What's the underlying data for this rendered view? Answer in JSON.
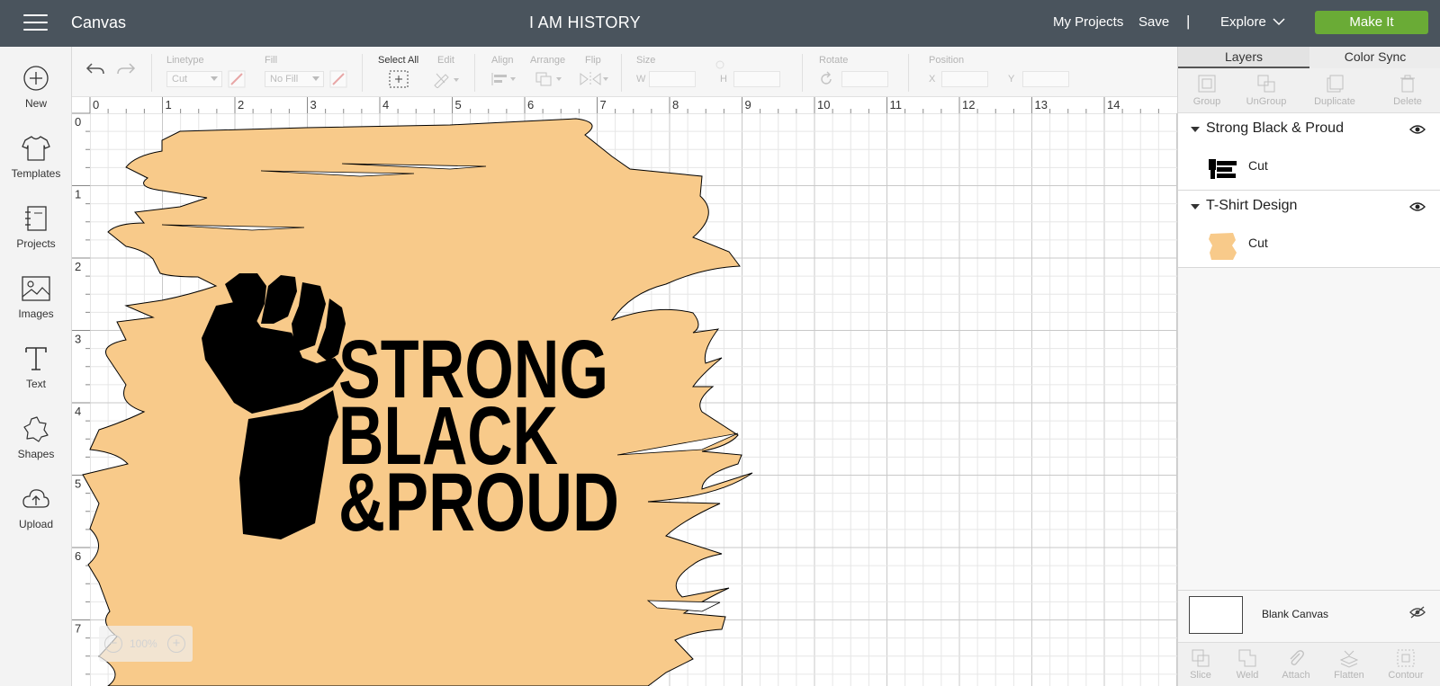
{
  "app": {
    "name": "Canvas",
    "project_title": "I AM HISTORY",
    "my_projects": "My Projects",
    "save": "Save",
    "separator": "|",
    "explore": "Explore",
    "make_it": "Make It"
  },
  "sidebar": {
    "items": [
      {
        "label": "New",
        "icon": "plus-circle-icon"
      },
      {
        "label": "Templates",
        "icon": "tshirt-icon"
      },
      {
        "label": "Projects",
        "icon": "notebook-icon"
      },
      {
        "label": "Images",
        "icon": "image-icon"
      },
      {
        "label": "Text",
        "icon": "text-icon"
      },
      {
        "label": "Shapes",
        "icon": "shapes-icon"
      },
      {
        "label": "Upload",
        "icon": "upload-cloud-icon"
      }
    ]
  },
  "toolbar": {
    "linetype_label": "Linetype",
    "linetype_value": "Cut",
    "fill_label": "Fill",
    "fill_value": "No Fill",
    "select_all": "Select All",
    "edit": "Edit",
    "align": "Align",
    "arrange": "Arrange",
    "flip": "Flip",
    "size": "Size",
    "size_w": "W",
    "size_h": "H",
    "rotate": "Rotate",
    "position": "Position",
    "pos_x": "X",
    "pos_y": "Y"
  },
  "ruler": {
    "h_ticks": [
      "0",
      "1",
      "2",
      "3",
      "4",
      "5",
      "6",
      "7",
      "8",
      "9",
      "10",
      "11",
      "12",
      "13",
      "14"
    ],
    "v_ticks": [
      "0",
      "1",
      "2",
      "3",
      "4",
      "5",
      "6",
      "7"
    ]
  },
  "design": {
    "line1": "STRONG",
    "line2": "BLACK",
    "line3": "&PROUD",
    "background_color": "#f8ca8a",
    "ink_color": "#000000"
  },
  "zoom": {
    "minus": "−",
    "value": "100%",
    "plus": "+"
  },
  "right_panel": {
    "tabs": [
      "Layers",
      "Color Sync"
    ],
    "actions": [
      "Group",
      "UnGroup",
      "Duplicate",
      "Delete"
    ],
    "layers": [
      {
        "name": "Strong Black & Proud",
        "operation": "Cut"
      },
      {
        "name": "T-Shirt Design",
        "operation": "Cut"
      }
    ],
    "blank_canvas": "Blank Canvas",
    "bottom_actions": [
      "Slice",
      "Weld",
      "Attach",
      "Flatten",
      "Contour"
    ]
  },
  "colors": {
    "topbar": "#4a545d",
    "make_it": "#6aab36",
    "design_fill": "#f8ca8a"
  }
}
